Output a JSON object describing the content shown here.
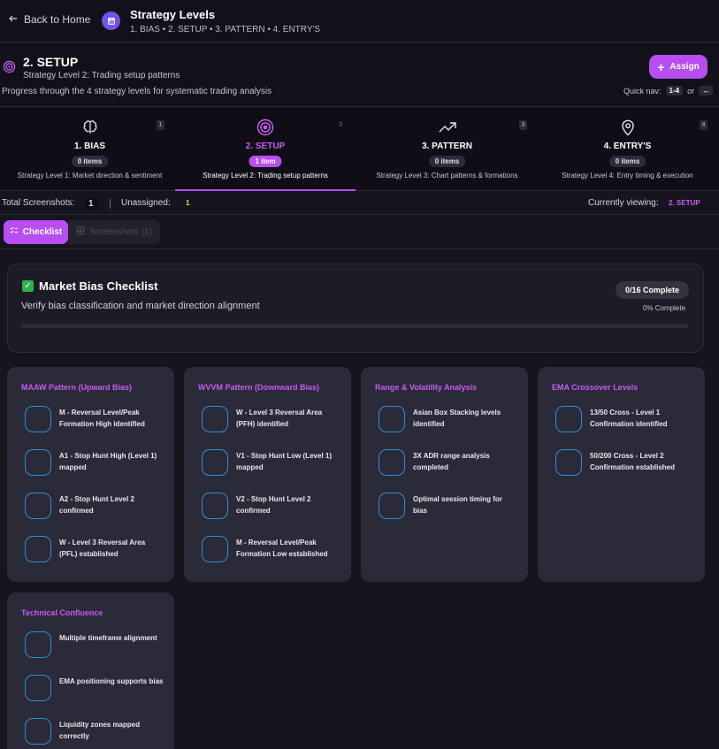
{
  "header": {
    "back_label": "Back to Home",
    "title": "Strategy Levels",
    "subtitle": "1. BIAS • 2. SETUP • 3. PATTERN • 4. ENTRY'S"
  },
  "level": {
    "title": "2. SETUP",
    "subtitle": "Strategy Level 2: Trading setup patterns",
    "description": "Progress through the 4 strategy levels for systematic trading analysis",
    "assign_label": "Assign",
    "quicknav_label": "Quick nav:",
    "quicknav_key1": "1-4",
    "quicknav_or": "or",
    "quicknav_key2": "↔"
  },
  "tabs": [
    {
      "num": "1",
      "title": "1. BIAS",
      "count": "0 items",
      "desc": "Strategy Level 1: Market direction & sentiment",
      "icon": "brain-icon"
    },
    {
      "num": "2",
      "title": "2. SETUP",
      "count": "1 item",
      "desc": "Strategy Level 2: Trading setup patterns",
      "icon": "target-icon",
      "active": true
    },
    {
      "num": "3",
      "title": "3. PATTERN",
      "count": "0 items",
      "desc": "Strategy Level 3: Chart patterns & formations",
      "icon": "trending-up-icon"
    },
    {
      "num": "4",
      "title": "4. ENTRY'S",
      "count": "0 items",
      "desc": "Strategy Level 4: Entry timing & execution",
      "icon": "map-pin-icon"
    }
  ],
  "stats": {
    "total_label": "Total Screenshots:",
    "total_value": "1",
    "unassigned_label": "Unassigned:",
    "unassigned_value": "1",
    "viewing_label": "Currently viewing:",
    "viewing_value": "2. SETUP"
  },
  "view_tabs": {
    "checklist_label": "Checklist",
    "screenshots_label": "Screenshots (1)"
  },
  "checklist": {
    "title": "Market Bias Checklist",
    "subtitle": "Verify bias classification and market direction alignment",
    "complete_badge": "0/16 Complete",
    "percent_label": "0% Complete",
    "progress": 0
  },
  "categories": [
    {
      "title": "MAAW Pattern (Upward Bias)",
      "items": [
        "M - Reversal Level/Peak Formation High identified",
        "A1 - Stop Hunt High (Level 1) mapped",
        "A2 - Stop Hunt Level 2 confirmed",
        "W - Level 3 Reversal Area (PFL) established"
      ]
    },
    {
      "title": "WVVM Pattern (Downward Bias)",
      "items": [
        "W - Level 3 Reversal Area (PFH) identified",
        "V1 - Stop Hunt Low (Level 1) mapped",
        "V2 - Stop Hunt Level 2 confirmed",
        "M - Reversal Level/Peak Formation Low established"
      ]
    },
    {
      "title": "Range & Volatility Analysis",
      "items": [
        "Asian Box Stacking levels identified",
        "3X ADR range analysis completed",
        "Optimal session timing for bias"
      ]
    },
    {
      "title": "EMA Crossover Levels",
      "items": [
        "13/50 Cross - Level 1 Confirmation identified",
        "50/200 Cross - Level 2 Confirmation established"
      ]
    },
    {
      "title": "Technical Confluence",
      "items": [
        "Multiple timeframe alignment",
        "EMA positioning supports bias",
        "Liquidity zones mapped correctly"
      ]
    }
  ],
  "colors": {
    "accent": "#b94ef0",
    "accent_text": "#c85bf2",
    "checkbox_border": "#2e8fd6",
    "background": "#16151f",
    "card": "#2b2a38"
  }
}
